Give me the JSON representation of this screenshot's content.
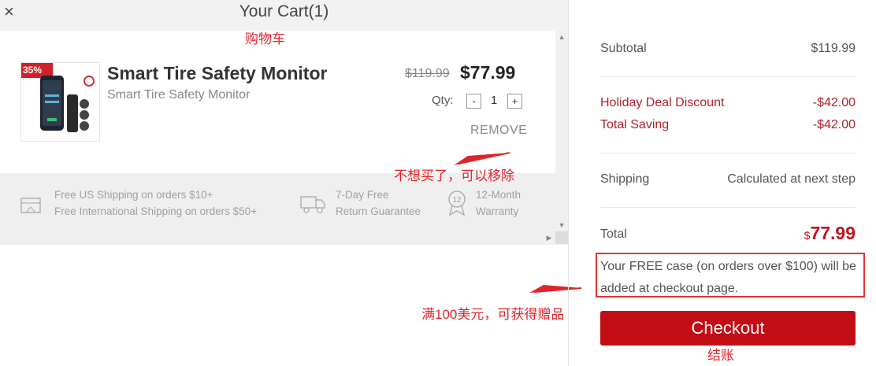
{
  "header": {
    "title": "Your Cart(1)",
    "close_icon": "×"
  },
  "item": {
    "badge": "35%",
    "name": "Smart Tire Safety Monitor",
    "subtitle": "Smart Tire Safety Monitor",
    "original_price": "$119.99",
    "price": "$77.99",
    "qty_label": "Qty:",
    "qty_minus": "-",
    "qty_value": "1",
    "qty_plus": "+",
    "remove_label": "REMOVE"
  },
  "features": [
    {
      "icon": "shipping-icon",
      "line1": "Free US Shipping on orders $10+",
      "line2": "Free International Shipping on orders $50+"
    },
    {
      "icon": "truck-icon",
      "line1": "7-Day Free",
      "line2": "Return Guarantee"
    },
    {
      "icon": "warranty-badge-icon",
      "badge_text": "12",
      "line1": "12-Month",
      "line2": "Warranty"
    }
  ],
  "annotations": {
    "cart": "购物车",
    "remove": "不想买了，可以移除",
    "gift": "满100美元，可获得赠品",
    "checkout": "结账"
  },
  "summary": {
    "subtotal_label": "Subtotal",
    "subtotal_value": "$119.99",
    "discount_label": "Holiday Deal Discount",
    "discount_value": "-$42.00",
    "saving_label": "Total Saving",
    "saving_value": "-$42.00",
    "shipping_label": "Shipping",
    "shipping_value": "Calculated at next step",
    "total_label": "Total",
    "total_currency": "$",
    "total_value": "77.99",
    "free_case_note": "Your FREE case (on orders over $100) will be added at checkout page.",
    "checkout_label": "Checkout"
  },
  "colors": {
    "accent": "#c20d15",
    "annotation": "#e0242b"
  }
}
